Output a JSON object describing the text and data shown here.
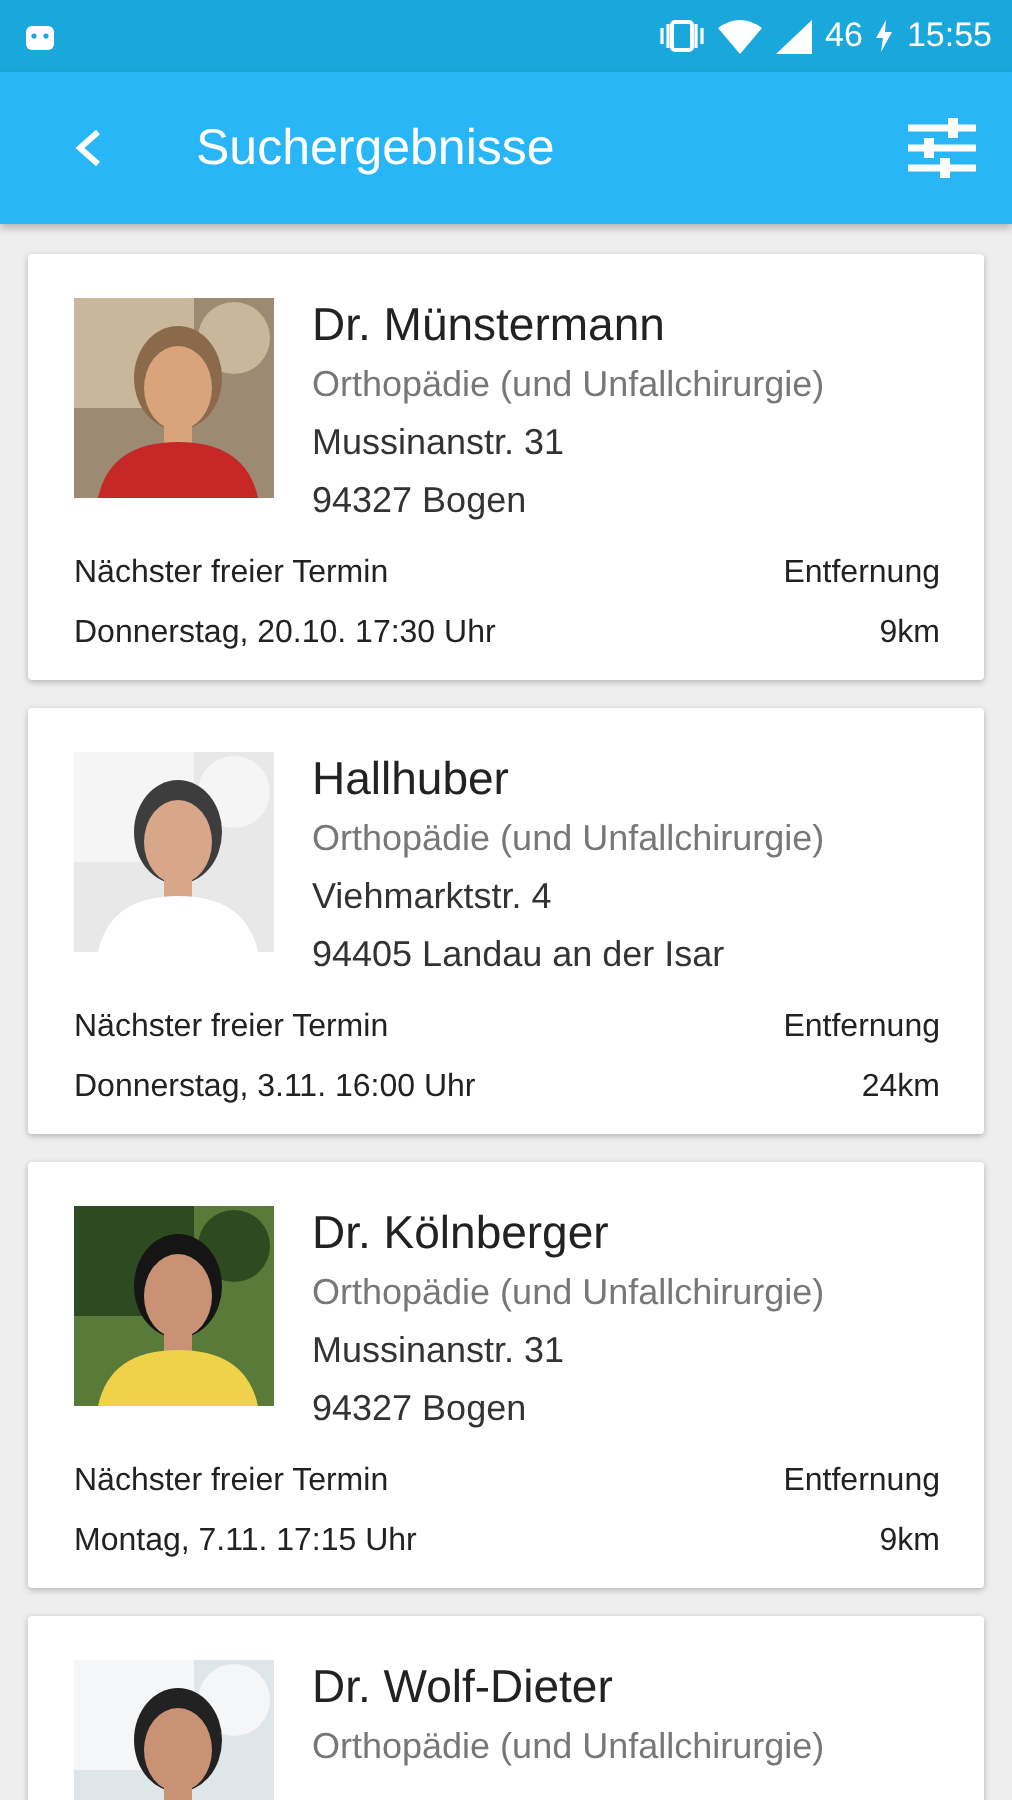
{
  "status_bar": {
    "network": "46",
    "time": "15:55"
  },
  "app_bar": {
    "title": "Suchergebnisse"
  },
  "results": [
    {
      "name": "Dr. Münstermann",
      "specialty": "Orthopädie (und Unfallchirurgie)",
      "street": "Mussinanstr. 31",
      "city": "94327 Bogen",
      "appointment_label": "Nächster freier Termin",
      "appointment": "Donnerstag, 20.10. 17:30 Uhr",
      "distance_label": "Entfernung",
      "distance": "9km"
    },
    {
      "name": "Hallhuber",
      "specialty": "Orthopädie (und Unfallchirurgie)",
      "street": "Viehmarktstr. 4",
      "city": "94405 Landau an der Isar",
      "appointment_label": "Nächster freier Termin",
      "appointment": "Donnerstag, 3.11. 16:00 Uhr",
      "distance_label": "Entfernung",
      "distance": "24km"
    },
    {
      "name": "Dr. Kölnberger",
      "specialty": "Orthopädie (und Unfallchirurgie)",
      "street": "Mussinanstr. 31",
      "city": "94327 Bogen",
      "appointment_label": "Nächster freier Termin",
      "appointment": "Montag, 7.11. 17:15 Uhr",
      "distance_label": "Entfernung",
      "distance": "9km"
    },
    {
      "name": "Dr. Wolf-Dieter",
      "specialty": "Orthopädie (und Unfallchirurgie)"
    }
  ]
}
